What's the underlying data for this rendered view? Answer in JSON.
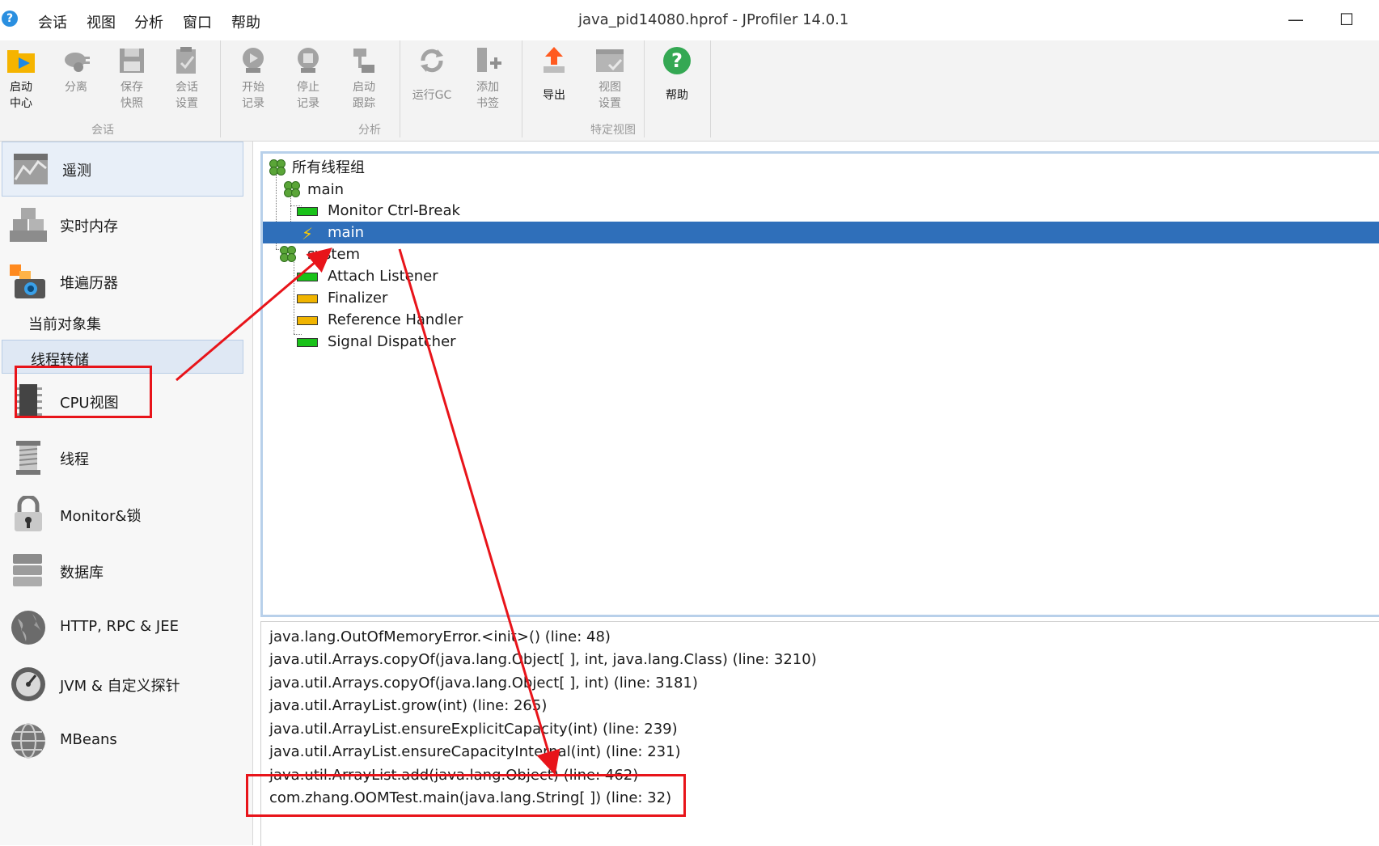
{
  "app": {
    "title": "java_pid14080.hprof - JProfiler 14.0.1",
    "icon": "jprofiler-logo-icon",
    "menu": [
      "会话",
      "视图",
      "分析",
      "窗口",
      "帮助"
    ],
    "window_controls": {
      "minimize": "—",
      "maximize": "☐"
    }
  },
  "toolbar": {
    "groups": [
      "会话",
      "分析",
      "特定视图"
    ],
    "buttons": [
      {
        "line1": "启动",
        "line2": "中心",
        "icon": "start-center-icon",
        "enabled": true
      },
      {
        "line1": "分离",
        "line2": "",
        "icon": "detach-icon",
        "enabled": false
      },
      {
        "line1": "保存",
        "line2": "快照",
        "icon": "save-snapshot-icon",
        "enabled": false
      },
      {
        "line1": "会话",
        "line2": "设置",
        "icon": "session-settings-icon",
        "enabled": false
      },
      {
        "line1": "开始",
        "line2": "记录",
        "icon": "start-recording-icon",
        "enabled": false
      },
      {
        "line1": "停止",
        "line2": "记录",
        "icon": "stop-recording-icon",
        "enabled": false
      },
      {
        "line1": "启动",
        "line2": "跟踪",
        "icon": "start-tracking-icon",
        "enabled": false
      },
      {
        "line1": "运行GC",
        "line2": "",
        "icon": "run-gc-icon",
        "enabled": false
      },
      {
        "line1": "添加",
        "line2": "书签",
        "icon": "add-bookmark-icon",
        "enabled": false
      },
      {
        "line1": "导出",
        "line2": "",
        "icon": "export-icon",
        "enabled": true
      },
      {
        "line1": "视图",
        "line2": "设置",
        "icon": "view-settings-icon",
        "enabled": false
      },
      {
        "line1": "帮助",
        "line2": "",
        "icon": "help-icon",
        "enabled": true
      }
    ]
  },
  "sidebar": {
    "items": [
      {
        "label": "遥测",
        "icon": "telemetry-icon"
      },
      {
        "label": "实时内存",
        "icon": "live-memory-icon"
      },
      {
        "label": "堆遍历器",
        "icon": "heap-walker-icon"
      },
      {
        "label": "当前对象集",
        "icon": ""
      },
      {
        "label": "线程转储",
        "icon": ""
      },
      {
        "label": "CPU视图",
        "icon": "cpu-view-icon"
      },
      {
        "label": "线程",
        "icon": "threads-icon"
      },
      {
        "label": "Monitor&锁",
        "icon": "lock-icon"
      },
      {
        "label": "数据库",
        "icon": "database-icon"
      },
      {
        "label": "HTTP, RPC & JEE",
        "icon": "http-globe-icon"
      },
      {
        "label": "JVM & 自定义探针",
        "icon": "jvm-probe-icon"
      },
      {
        "label": "MBeans",
        "icon": "mbeans-icon"
      }
    ],
    "selected": "线程转储"
  },
  "thread_tree": {
    "rows": [
      {
        "label": "所有线程组",
        "kind": "group"
      },
      {
        "label": "main",
        "kind": "group"
      },
      {
        "label": "Monitor Ctrl-Break",
        "kind": "thread",
        "state": "running"
      },
      {
        "label": "main",
        "kind": "thread",
        "state": "current"
      },
      {
        "label": "system",
        "kind": "group"
      },
      {
        "label": "Attach Listener",
        "kind": "thread",
        "state": "running"
      },
      {
        "label": "Finalizer",
        "kind": "thread",
        "state": "waiting"
      },
      {
        "label": "Reference Handler",
        "kind": "thread",
        "state": "waiting"
      },
      {
        "label": "Signal Dispatcher",
        "kind": "thread",
        "state": "running"
      }
    ],
    "colors": {
      "running": "#19c219",
      "waiting": "#f0b400",
      "selection": "#2f6fba"
    }
  },
  "stack_trace": {
    "frames": [
      "java.lang.OutOfMemoryError.<init>() (line: 48)",
      "java.util.Arrays.copyOf(java.lang.Object[ ], int, java.lang.Class) (line: 3210)",
      "java.util.Arrays.copyOf(java.lang.Object[ ], int) (line: 3181)",
      "java.util.ArrayList.grow(int) (line: 265)",
      "java.util.ArrayList.ensureExplicitCapacity(int) (line: 239)",
      "java.util.ArrayList.ensureCapacityInternal(int) (line: 231)",
      "java.util.ArrayList.add(java.lang.Object) (line: 462)",
      "com.zhang.OOMTest.main(java.lang.String[ ]) (line: 32)"
    ]
  },
  "annotation_color": "#e8141a"
}
